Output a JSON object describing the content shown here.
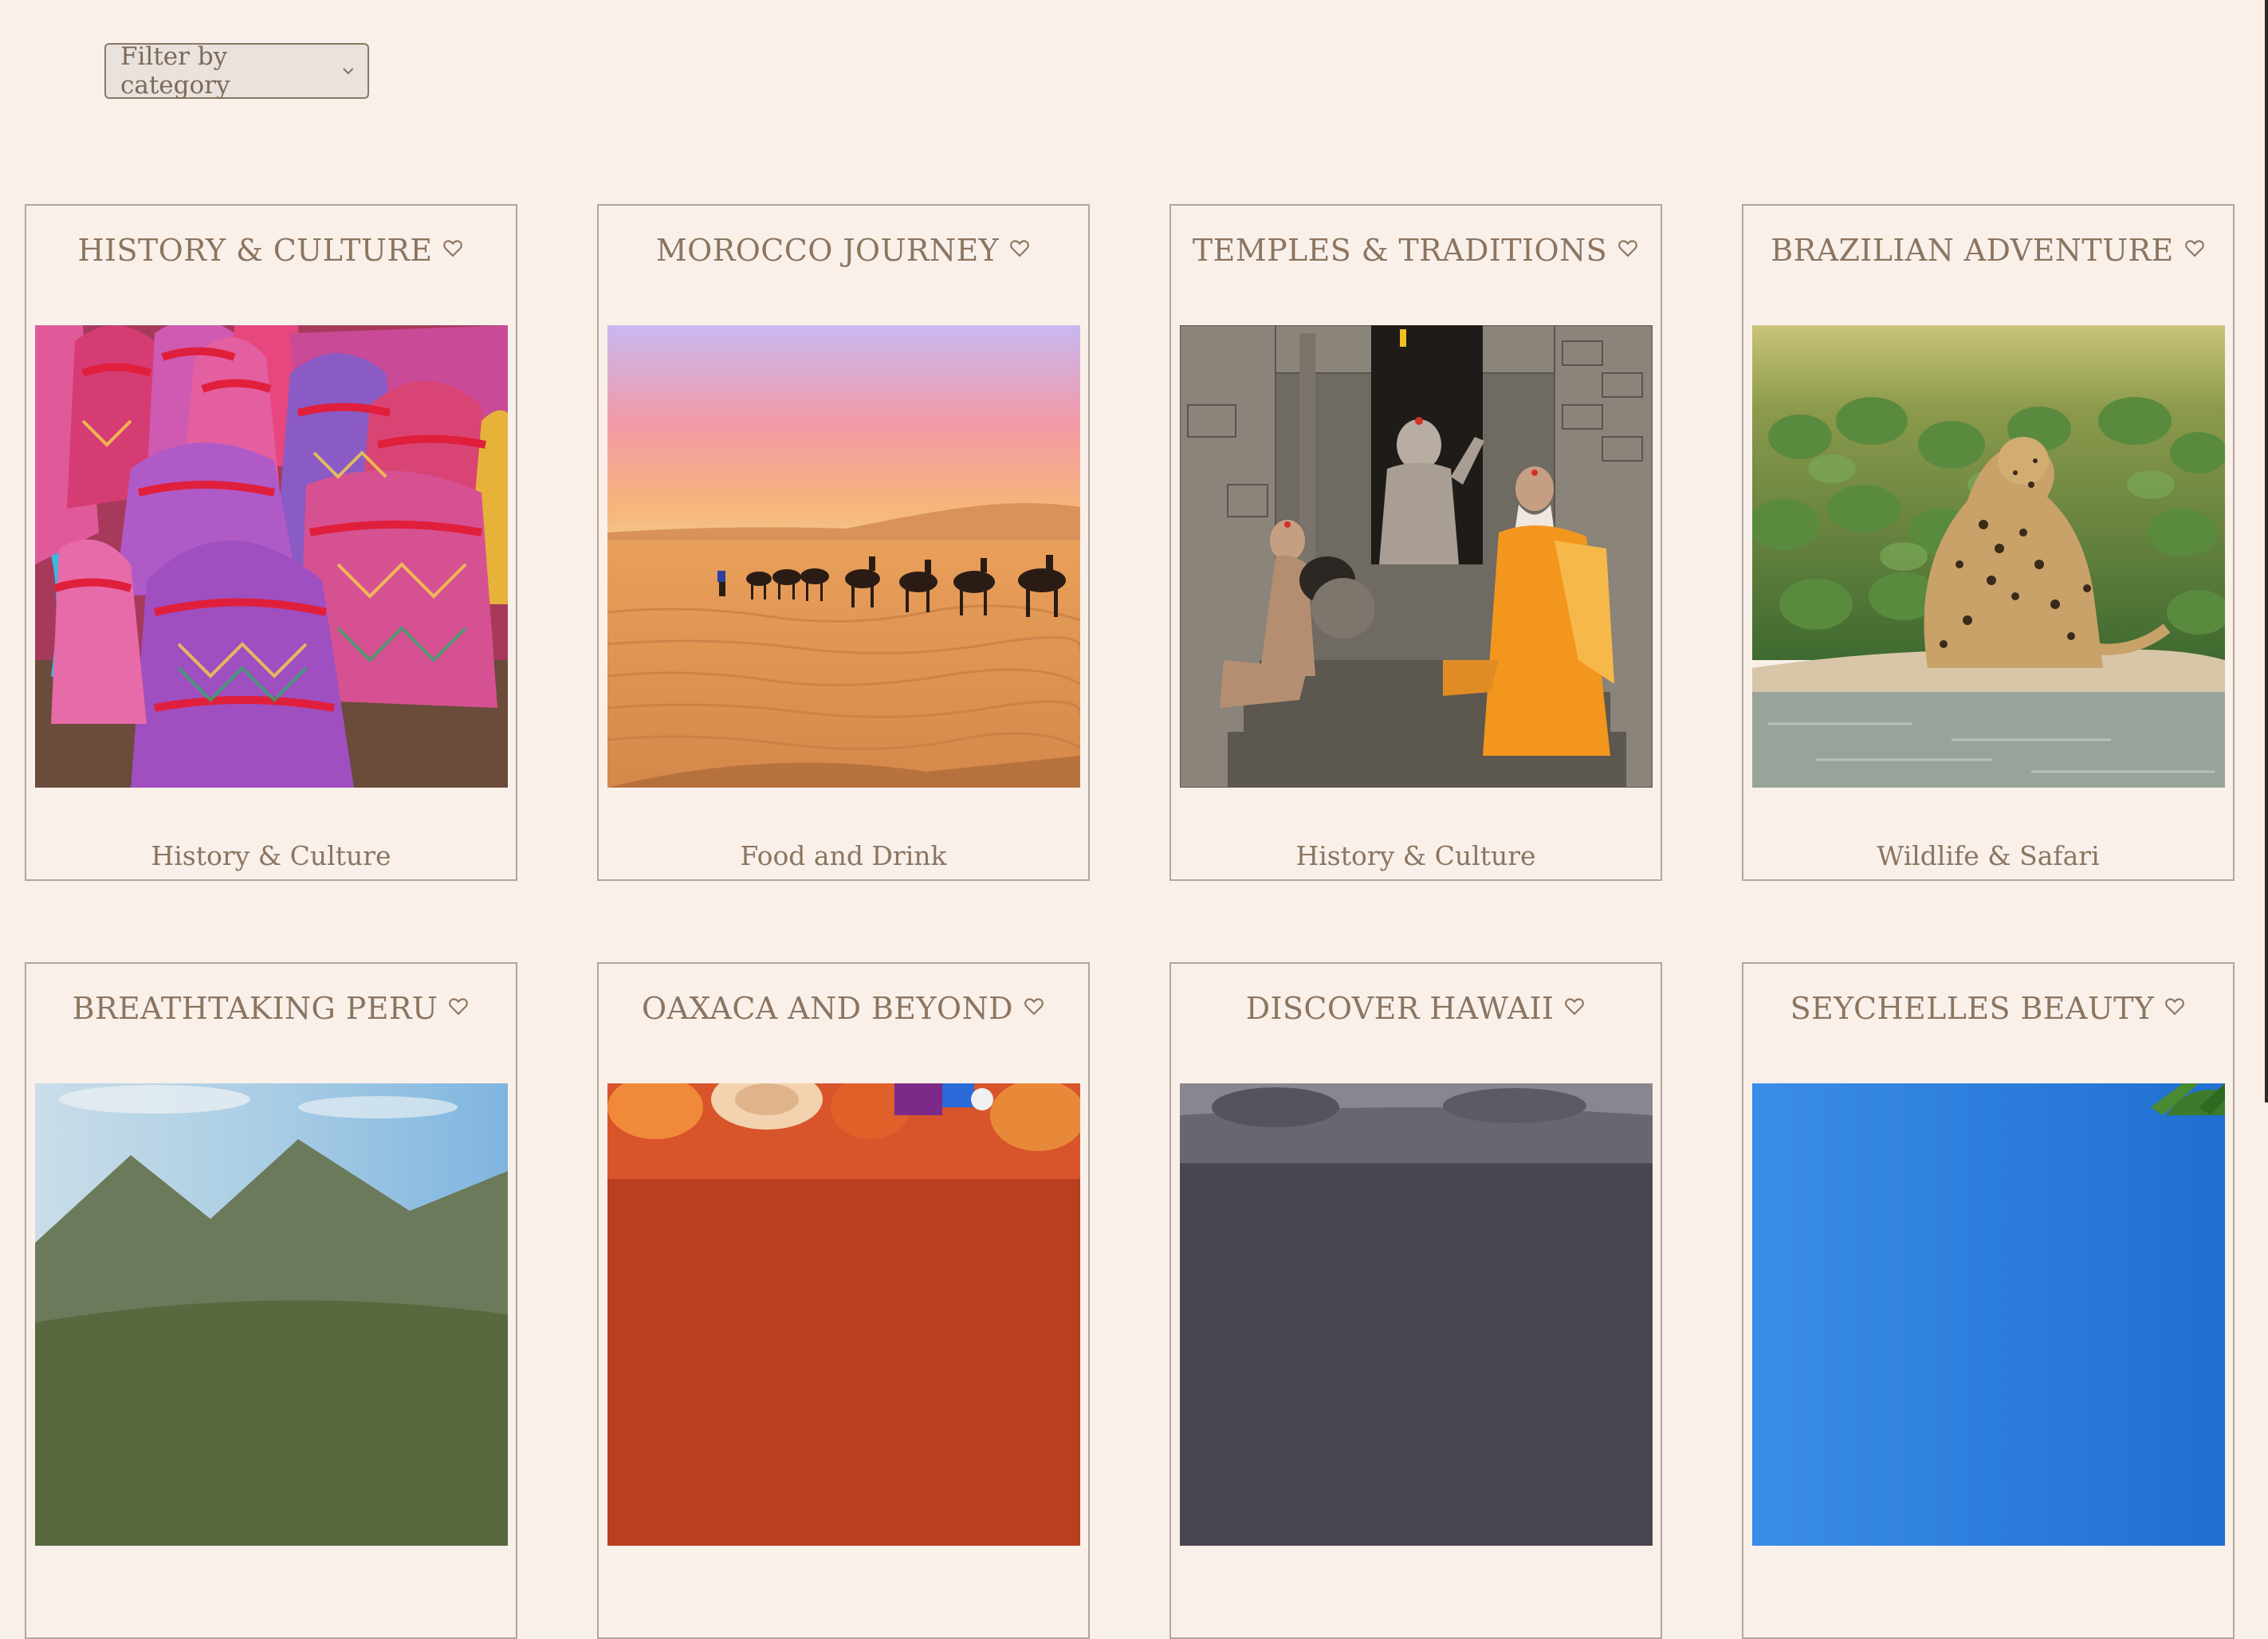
{
  "filter": {
    "placeholder": "Filter by category"
  },
  "tours": [
    {
      "title": "HISTORY & CULTURE",
      "category": "History & Culture",
      "image": "colorful-woven-baskets"
    },
    {
      "title": "MOROCCO JOURNEY",
      "category": "Food and Drink",
      "image": "camel-caravan-desert-sunset"
    },
    {
      "title": "TEMPLES & TRADITIONS",
      "category": "History & Culture",
      "image": "sadhus-at-stone-temple"
    },
    {
      "title": "BRAZILIAN ADVENTURE",
      "category": "Wildlife & Safari",
      "image": "jaguar-by-river"
    },
    {
      "title": "BREATHTAKING PERU",
      "category": "",
      "image": "peru-landscape"
    },
    {
      "title": "OAXACA AND BEYOND",
      "category": "",
      "image": "oaxaca-food"
    },
    {
      "title": "DISCOVER HAWAII",
      "category": "",
      "image": "hawaii-rocks"
    },
    {
      "title": "SEYCHELLES BEAUTY",
      "category": "",
      "image": "seychelles-sky-palm"
    }
  ],
  "colors": {
    "background": "#f9f0ea",
    "text": "#8c7560",
    "border": "#b4a69b"
  },
  "icons": {
    "favorite": "heart-outline-icon",
    "dropdown": "chevron-down-icon"
  }
}
